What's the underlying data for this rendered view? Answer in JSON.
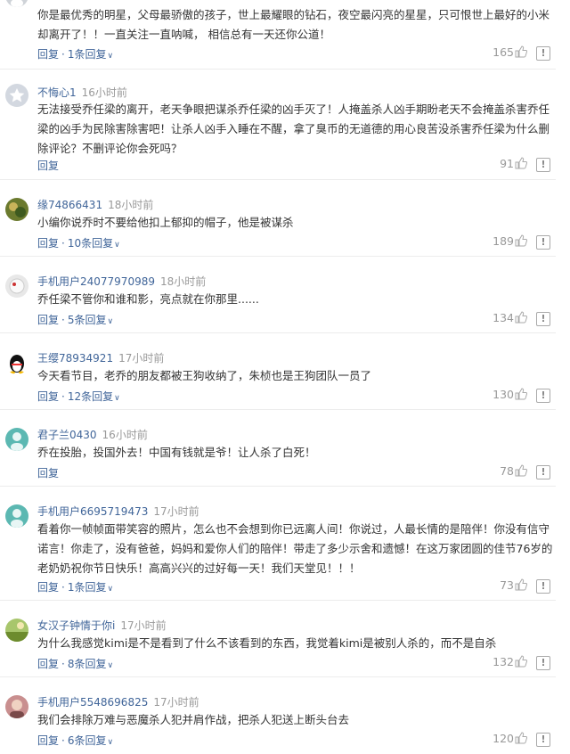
{
  "comments": [
    {
      "user": "",
      "time": "",
      "avatar": "gray-face",
      "text": "你是最优秀的明星，父母最骄傲的孩子，世上最耀眼的钻石，夜空最闪亮的星星，只可恨世上最好的小米却离开了！！一直关注一直呐喊， 相信总有一天还你公道！",
      "reply_label": "回复",
      "replies_label": "1条回复",
      "likes": "165"
    },
    {
      "user": "不悔心1",
      "time": "16小时前",
      "avatar": "gray-star",
      "text": "无法接受乔任梁的离开，老天争眼把谋杀乔任梁的凶手灭了！人掩盖杀人凶手期盼老天不会掩盖杀害乔任梁的凶手为民除害除害吧！让杀人凶手入睡在不醒，拿了臭币的无道德的用心良苦没杀害乔任梁为什么删除评论？不删评论你会死吗？",
      "reply_label": "回复",
      "replies_label": "",
      "likes": "91"
    },
    {
      "user": "缘74866431",
      "time": "18小时前",
      "avatar": "photo-green",
      "text": "小编你说乔时不要给他扣上郁抑的帽子，他是被谋杀",
      "reply_label": "回复",
      "replies_label": "10条回复",
      "likes": "189"
    },
    {
      "user": "手机用户24077970989",
      "time": "18小时前",
      "avatar": "photo-white",
      "text": "乔任梁不管你和谁和影，亮点就在你那里......",
      "reply_label": "回复",
      "replies_label": "5条回复",
      "likes": "134"
    },
    {
      "user": "王缨78934921",
      "time": "17小时前",
      "avatar": "penguin",
      "text": "今天看节目，老乔的朋友都被王狗收纳了，朱桢也是王狗团队一员了",
      "reply_label": "回复",
      "replies_label": "12条回复",
      "likes": "130"
    },
    {
      "user": "君子兰0430",
      "time": "16小时前",
      "avatar": "teal-face",
      "text": "乔在投胎，投国外去！中国有钱就是爷！让人杀了白死！",
      "reply_label": "回复",
      "replies_label": "",
      "likes": "78"
    },
    {
      "user": "手机用户6695719473",
      "time": "17小时前",
      "avatar": "teal-face",
      "text": "看着你一帧帧面带笑容的照片，怎么也不会想到你已远离人间！你说过，人最长情的是陪伴！你没有信守诺言！你走了，没有爸爸，妈妈和爱你人们的陪伴！带走了多少示舍和遗憾！在这万家团圆的佳节76岁的老奶奶祝你节日快乐！高高兴兴的过好每一天！我们天堂见！！！",
      "reply_label": "回复",
      "replies_label": "1条回复",
      "likes": "73"
    },
    {
      "user": "女汉子钟情于你i",
      "time": "17小时前",
      "avatar": "photo-field",
      "text": "为什么我感觉kimi是不是看到了什么不该看到的东西，我觉着kimi是被别人杀的，而不是自杀",
      "reply_label": "回复",
      "replies_label": "8条回复",
      "likes": "132"
    },
    {
      "user": "手机用户5548696825",
      "time": "17小时前",
      "avatar": "photo-pink",
      "text": "我们会排除万难与恶魔杀人犯并肩作战，把杀人犯送上断头台去",
      "reply_label": "回复",
      "replies_label": "6条回复",
      "likes": "120"
    }
  ]
}
